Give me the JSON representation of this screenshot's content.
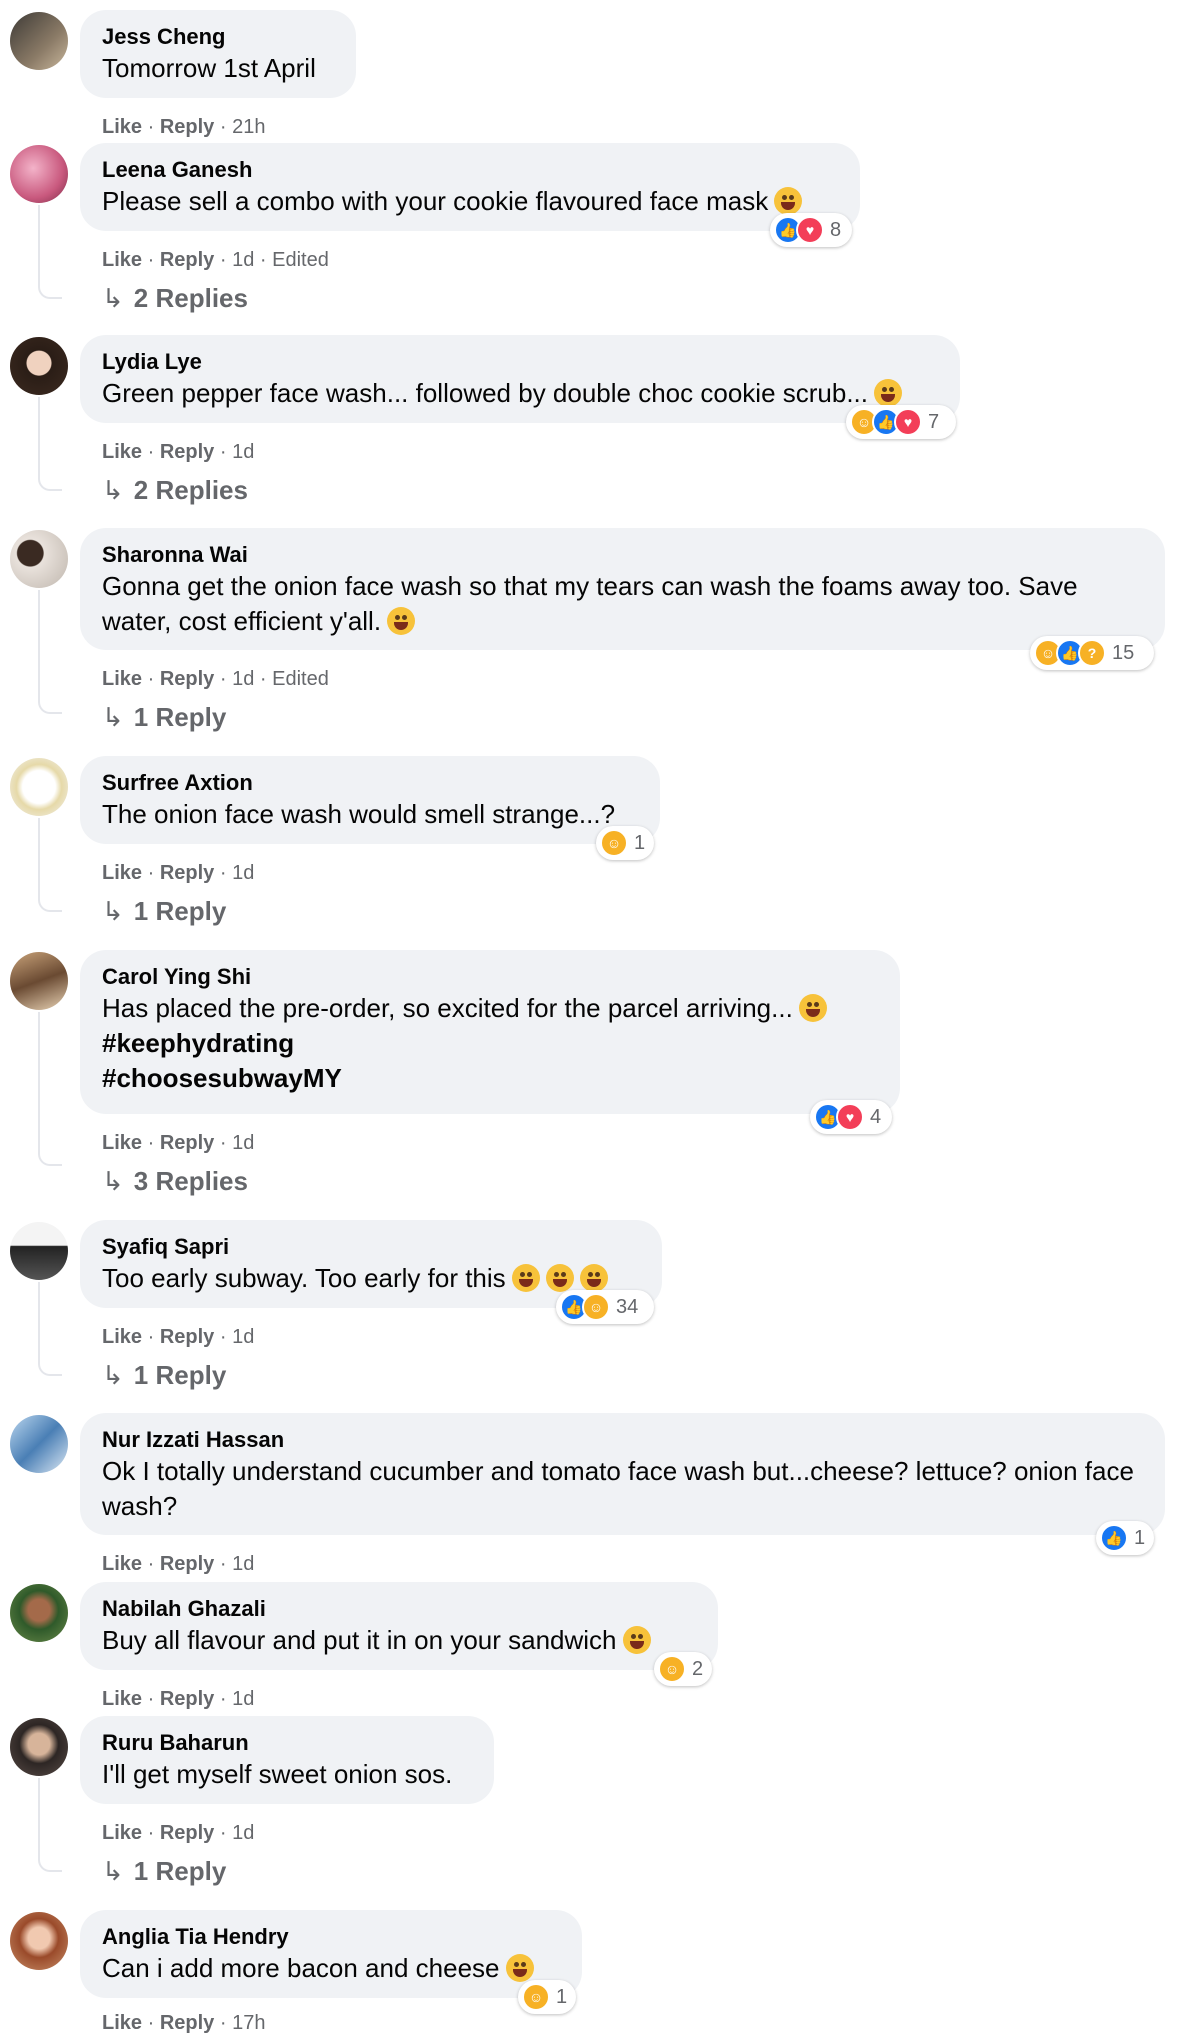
{
  "colors": {
    "bubble": "#f0f2f5",
    "meta": "#65676b",
    "like": "#1877f2",
    "love": "#f33e58",
    "haha": "#f7b125"
  },
  "actions": {
    "like": "Like",
    "reply": "Reply",
    "sep": "·"
  },
  "comments": [
    {
      "author": "Jess Cheng",
      "text": "Tomorrow 1st April",
      "time": "21h",
      "edited": "",
      "replies": "",
      "reactions": [],
      "reaction_count": ""
    },
    {
      "author": "Leena Ganesh",
      "text": "Please sell a combo with your cookie flavoured face mask",
      "time": "1d",
      "edited": "Edited",
      "replies": "2 Replies",
      "reactions": [
        "like",
        "love"
      ],
      "reaction_count": "8"
    },
    {
      "author": "Lydia Lye",
      "text": "Green pepper face wash... followed by double choc cookie scrub...",
      "time": "1d",
      "edited": "",
      "replies": "2 Replies",
      "reactions": [
        "haha",
        "like",
        "love"
      ],
      "reaction_count": "7"
    },
    {
      "author": "Sharonna Wai",
      "text": "Gonna get the onion face wash so that my tears can wash the foams away too. Save water, cost efficient y'all.",
      "time": "1d",
      "edited": "Edited",
      "replies": "1 Reply",
      "reactions": [
        "haha",
        "like",
        "wow"
      ],
      "reaction_count": "15"
    },
    {
      "author": "Surfree Axtion",
      "text": "The onion face wash would smell strange...?",
      "time": "1d",
      "edited": "",
      "replies": "1 Reply",
      "reactions": [
        "haha"
      ],
      "reaction_count": "1"
    },
    {
      "author": "Carol Ying Shi",
      "text": "Has placed the pre-order, so excited for the parcel arriving...",
      "hashtag1": "#keephydrating",
      "hashtag2": "#choosesubwayMY",
      "time": "1d",
      "edited": "",
      "replies": "3 Replies",
      "reactions": [
        "like",
        "love"
      ],
      "reaction_count": "4"
    },
    {
      "author": "Syafiq Sapri",
      "text": "Too early subway. Too early for this",
      "time": "1d",
      "edited": "",
      "replies": "1 Reply",
      "reactions": [
        "like",
        "haha"
      ],
      "reaction_count": "34"
    },
    {
      "author": "Nur Izzati Hassan",
      "text": "Ok I totally understand cucumber and tomato face wash but...cheese? lettuce? onion face wash?",
      "time": "1d",
      "edited": "",
      "replies": "",
      "reactions": [
        "like"
      ],
      "reaction_count": "1"
    },
    {
      "author": "Nabilah Ghazali",
      "text": "Buy all flavour and put it in on your sandwich",
      "time": "1d",
      "edited": "",
      "replies": "",
      "reactions": [
        "haha"
      ],
      "reaction_count": "2"
    },
    {
      "author": "Ruru Baharun",
      "text": "I'll get myself sweet onion sos.",
      "time": "1d",
      "edited": "",
      "replies": "1 Reply",
      "reactions": [],
      "reaction_count": ""
    },
    {
      "author": "Anglia Tia Hendry",
      "text": "Can i add more bacon and cheese",
      "time": "17h",
      "edited": "",
      "replies": "",
      "reactions": [
        "haha"
      ],
      "reaction_count": "1"
    }
  ]
}
